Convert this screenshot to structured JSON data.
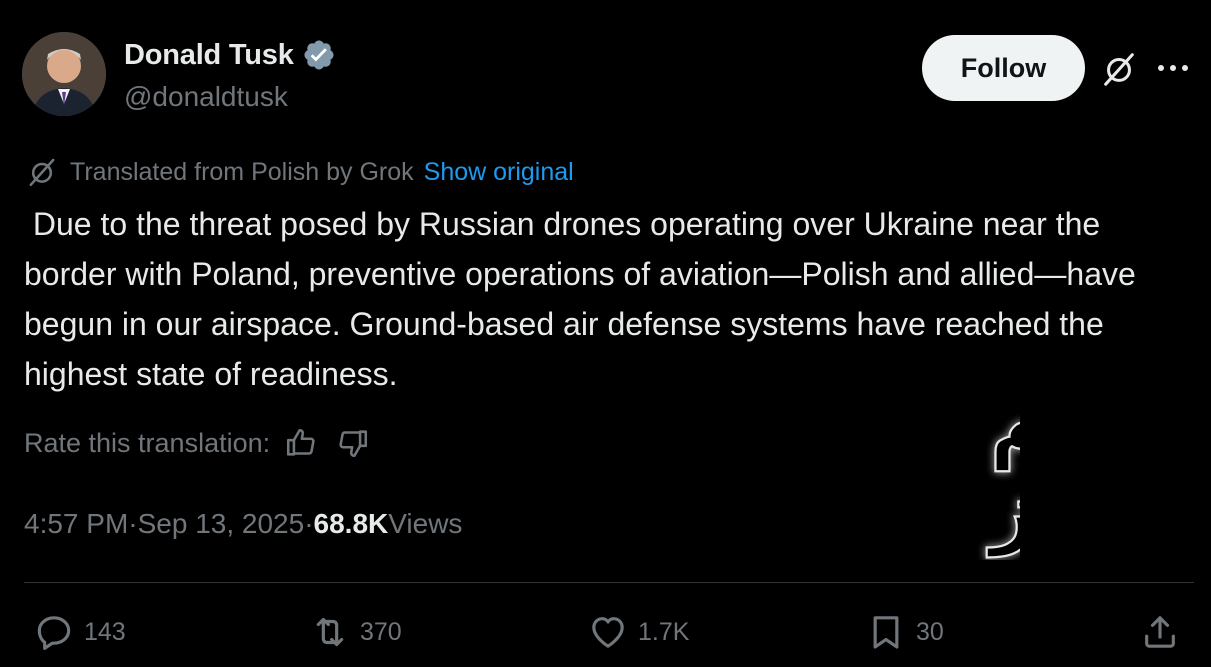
{
  "author": {
    "name": "Donald Tusk",
    "handle": "@donaldtusk",
    "verified_color": "#829aab"
  },
  "header": {
    "follow_label": "Follow"
  },
  "translation": {
    "note": "Translated from Polish by Grok",
    "show_original_label": "Show original",
    "link_color": "#1d9bf0"
  },
  "tweet": {
    "text": " Due to the threat posed by Russian drones operating over Ukraine near the border with Poland, preventive operations of aviation—Polish and allied—have begun in our airspace. Ground-based air defense systems have reached the highest state of readiness."
  },
  "rating": {
    "label": "Rate this translation:"
  },
  "meta": {
    "time": "4:57 PM",
    "separator": " · ",
    "date": "Sep 13, 2025",
    "views_count": "68.8K",
    "views_label": " Views"
  },
  "actions": {
    "replies": "143",
    "reposts": "370",
    "likes": "1.7K",
    "bookmarks": "30"
  },
  "watermark": {
    "line1": "نظام",
    "line2": "نیوز"
  },
  "icons": {
    "grok": "grok-icon",
    "more": "more-icon",
    "thumbs_up": "thumbs-up-icon",
    "thumbs_down": "thumbs-down-icon",
    "reply": "reply-icon",
    "repost": "repost-icon",
    "like": "heart-icon",
    "bookmark": "bookmark-icon",
    "share": "share-icon"
  }
}
